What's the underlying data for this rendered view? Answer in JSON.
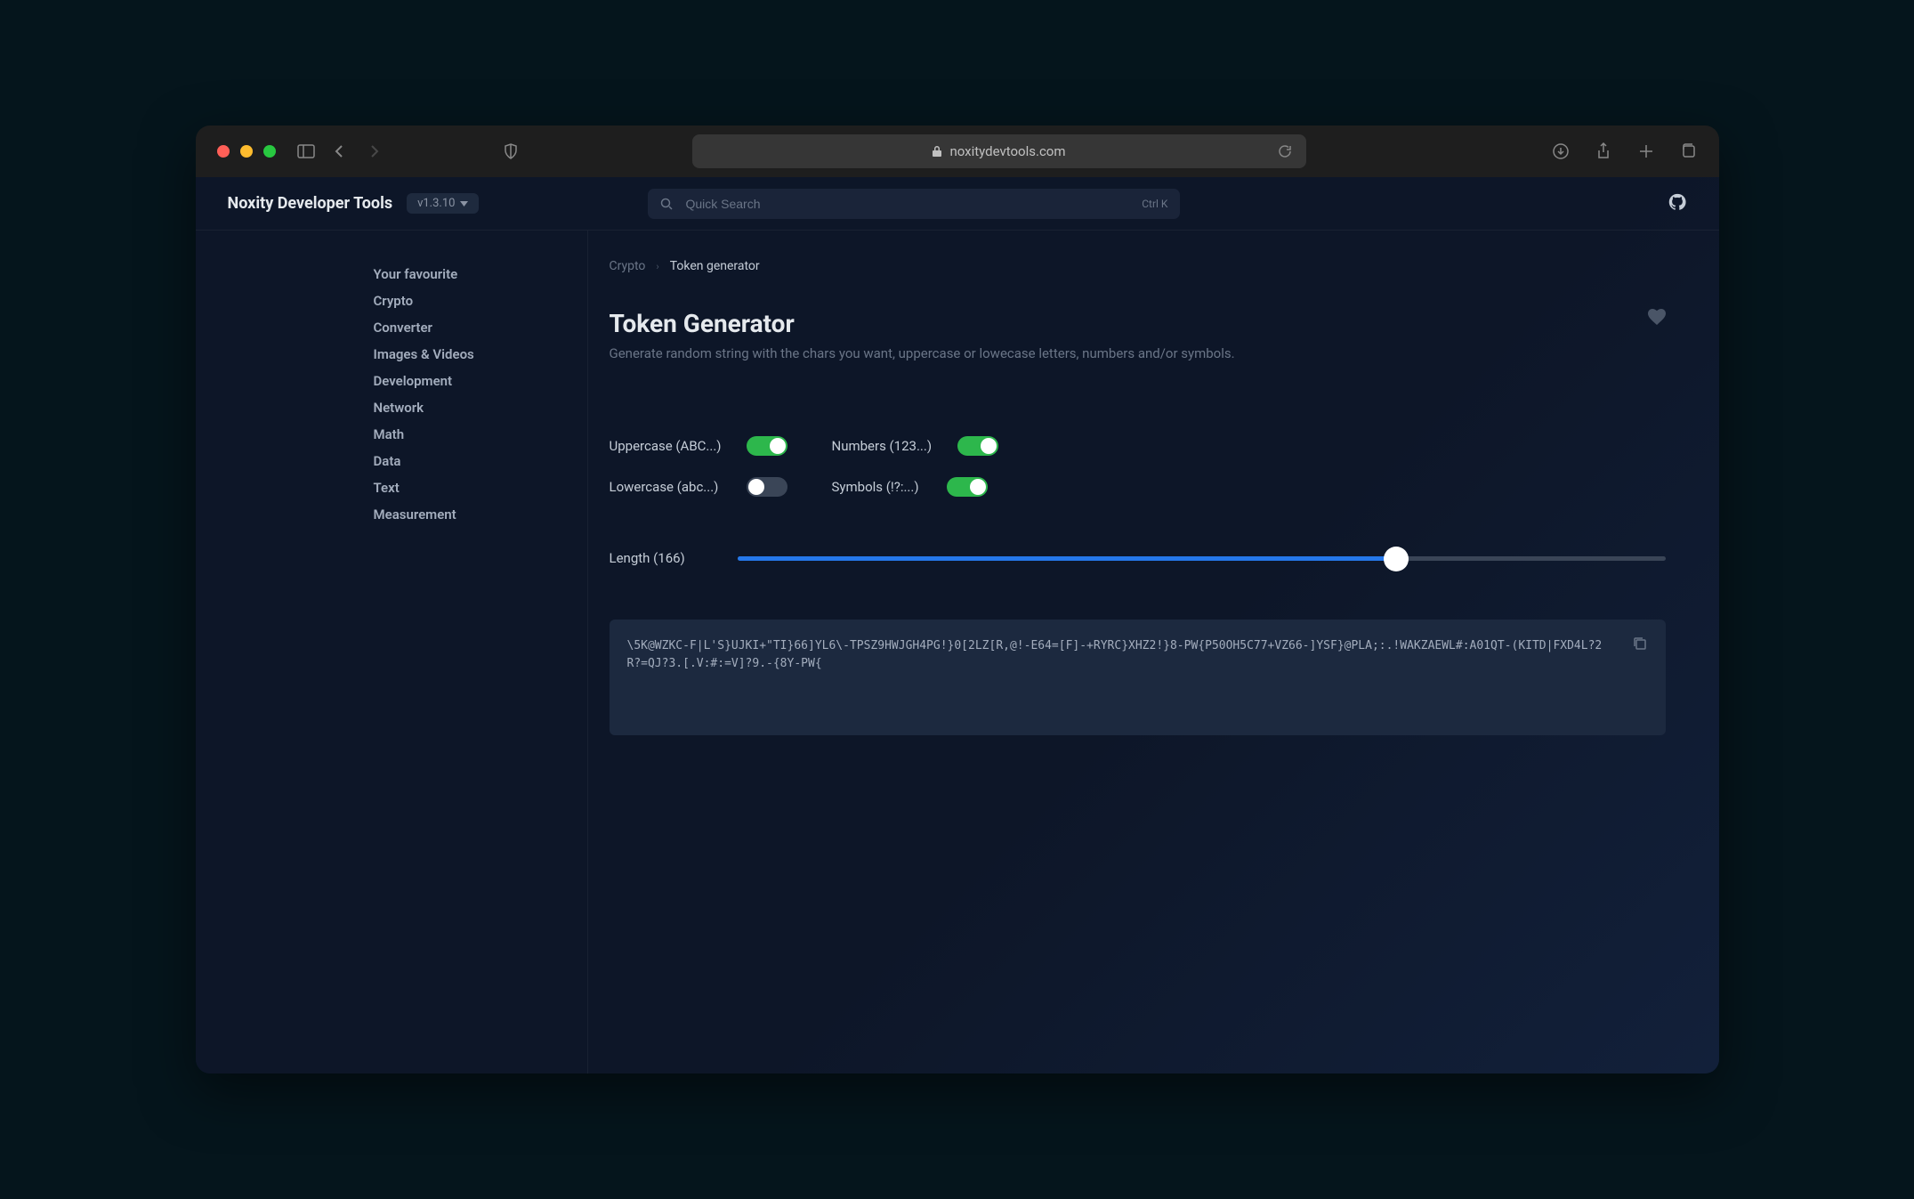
{
  "browser": {
    "url": "noxitydevtools.com"
  },
  "header": {
    "title": "Noxity Developer Tools",
    "version": "v1.3.10",
    "search_placeholder": "Quick Search",
    "shortcut": "Ctrl K"
  },
  "sidebar": {
    "items": [
      {
        "label": "Your favourite"
      },
      {
        "label": "Crypto"
      },
      {
        "label": "Converter"
      },
      {
        "label": "Images & Videos"
      },
      {
        "label": "Development"
      },
      {
        "label": "Network"
      },
      {
        "label": "Math"
      },
      {
        "label": "Data"
      },
      {
        "label": "Text"
      },
      {
        "label": "Measurement"
      }
    ]
  },
  "breadcrumbs": {
    "items": [
      {
        "label": "Crypto"
      },
      {
        "label": "Token generator"
      }
    ]
  },
  "page": {
    "title": "Token Generator",
    "description": "Generate random string with the chars you want, uppercase or lowecase letters, numbers and/or symbols."
  },
  "toggles": {
    "uppercase": {
      "label": "Uppercase (ABC...)",
      "on": true
    },
    "numbers": {
      "label": "Numbers (123...)",
      "on": true
    },
    "lowercase": {
      "label": "Lowercase (abc...)",
      "on": false
    },
    "symbols": {
      "label": "Symbols (!?:...)",
      "on": true
    }
  },
  "slider": {
    "label": "Length (166)",
    "value": 166,
    "max": 240,
    "percent": 71
  },
  "output": {
    "value": "\\5K@WZKC-F|L'S}UJKI+\"TI}66]YL6\\-TPSZ9HWJGH4PG!}0[2LZ[R,@!-E64=[F]-+RYRC}XHZ2!}8-PW{P50OH5C77+VZ66-]YSF}@PLA;:.!WAKZAEWL#:A01QT-(KITD|FXD4L?2R?=QJ?3.[.V:#:=V]?9.-{8Y-PW{"
  }
}
